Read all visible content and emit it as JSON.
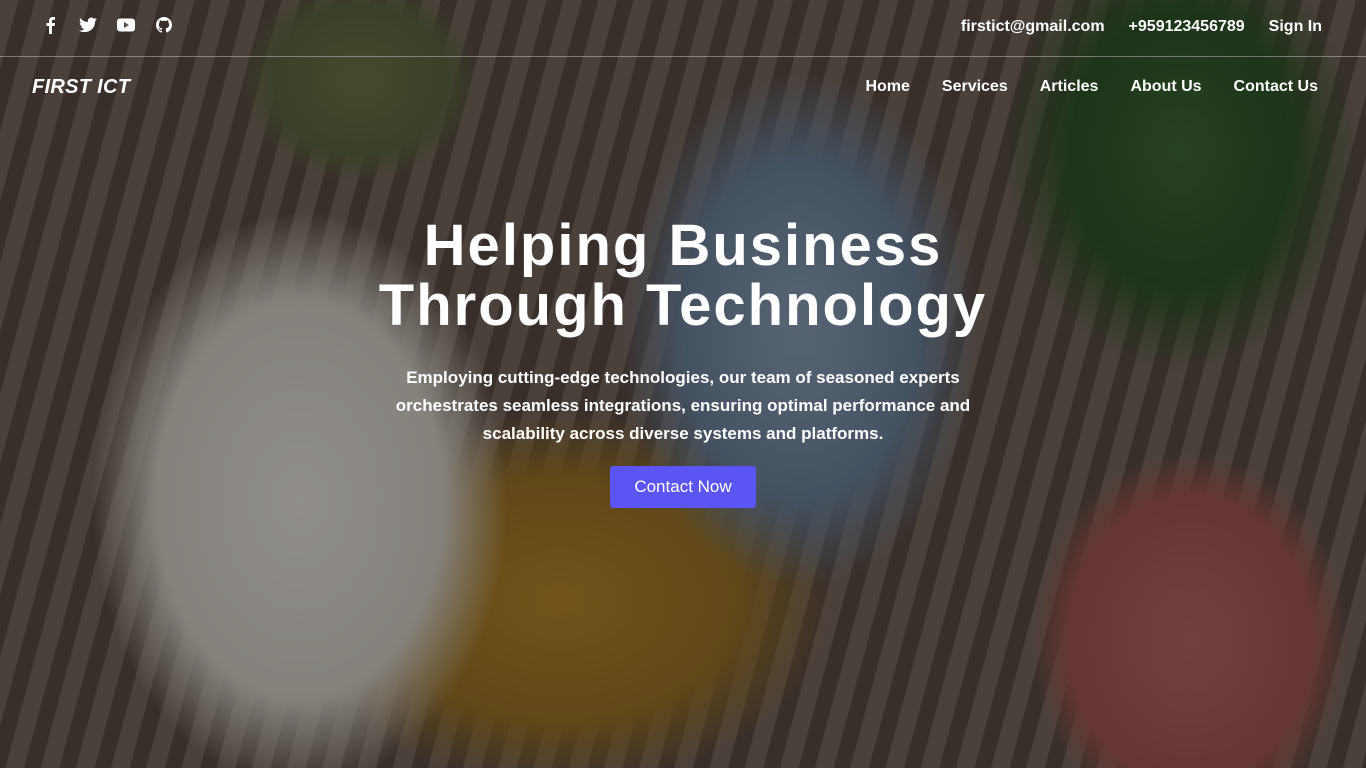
{
  "topbar": {
    "social_icons": [
      "facebook-icon",
      "twitter-icon",
      "youtube-icon",
      "github-icon"
    ],
    "email": "firstict@gmail.com",
    "phone": "+959123456789",
    "signin": "Sign In"
  },
  "nav": {
    "brand": "FIRST ICT",
    "items": [
      {
        "label": "Home"
      },
      {
        "label": "Services"
      },
      {
        "label": "Articles"
      },
      {
        "label": "About Us"
      },
      {
        "label": "Contact Us"
      }
    ]
  },
  "hero": {
    "headline": "Helping Business Through Technology",
    "subtext": "Employing cutting-edge technologies, our team of seasoned experts orchestrates seamless integrations, ensuring optimal performance and scalability across diverse systems and platforms.",
    "cta": "Contact Now"
  },
  "colors": {
    "accent": "#5b55f5",
    "text": "#ffffff"
  }
}
